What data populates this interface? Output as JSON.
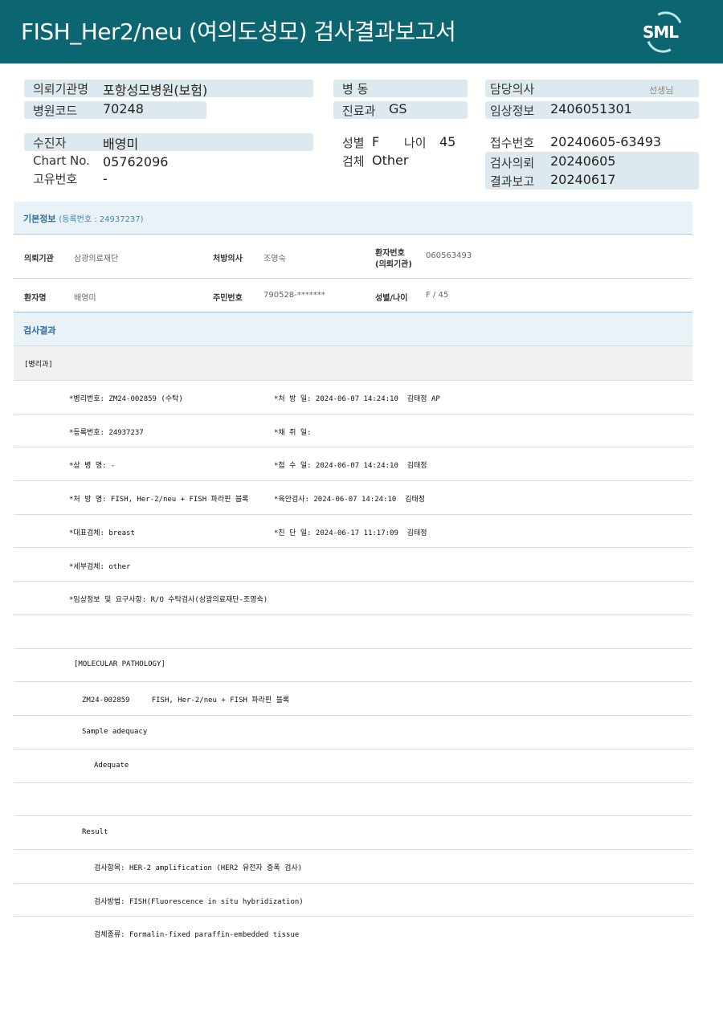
{
  "header": {
    "title": "FISH_Her2/neu (여의도성모) 검사결과보고서",
    "logo_text": "SML"
  },
  "summary": {
    "institution": {
      "label": "의뢰기관명",
      "value": "포항성모병원(보험)"
    },
    "hospital_code": {
      "label": "병원코드",
      "value": "70248"
    },
    "ward": {
      "label": "병   동",
      "value": ""
    },
    "department": {
      "label": "진료과",
      "value": "GS"
    },
    "doctor": {
      "label": "담당의사",
      "value": "",
      "suffix": "선생님"
    },
    "clinical_info": {
      "label": "임상정보",
      "value": "2406051301"
    },
    "patient": {
      "label": "수진자",
      "value": "배영미"
    },
    "chart_no": {
      "label": "Chart No.",
      "value": "05762096"
    },
    "unique_no": {
      "label": "고유번호",
      "value": "-"
    },
    "sex": {
      "label": "성별",
      "value": "F"
    },
    "age": {
      "label": "나이",
      "value": "45"
    },
    "specimen": {
      "label": "검체",
      "value": "Other"
    },
    "receipt_no": {
      "label": "접수번호",
      "value": "20240605-63493"
    },
    "request_date": {
      "label": "검사의뢰",
      "value": "20240605"
    },
    "report_date": {
      "label": "결과보고",
      "value": "20240617"
    }
  },
  "basic_info": {
    "title": "기본정보",
    "reg_label": "(등록번호 : 24937237)",
    "institution_label": "의뢰기관",
    "institution_value": "삼광의료재단",
    "physician_label": "처방의사",
    "physician_value": "조영숙",
    "patient_no_label_1": "환자번호",
    "patient_no_label_2": "(의뢰기관)",
    "patient_no_value": "060563493",
    "patient_name_label": "환자명",
    "patient_name_value": "배영미",
    "resident_no_label": "주민번호",
    "resident_no_value": "790528-*******",
    "sex_age_label": "성별/나이",
    "sex_age_value": "F / 45"
  },
  "results": {
    "title": "검사결과",
    "dept": "[병리과]",
    "lines": [
      {
        "left": "*병리번호: ZM24-002859 (수탁)",
        "right": "*처 방 일: 2024-06-07 14:24:10  김태정 AP"
      },
      {
        "left": "*등록번호: 24937237",
        "right": "*채 취 일:"
      },
      {
        "left": "*상 병 명: -",
        "right": "*접 수 일: 2024-06-07 14:24:10  김태정"
      },
      {
        "left": "*처 방 명: FISH, Her-2/neu + FISH 파라핀 블록",
        "right": "*육안검사: 2024-06-07 14:24:10  김태정"
      },
      {
        "left": "*대표검체: breast",
        "right": "*진 단 일: 2024-06-17 11:17:09  김태정"
      },
      {
        "left": "*세부검체: other",
        "right": ""
      },
      {
        "left": "*임상정보 및 요구사항: R/O 수탁검사(삼광의료재단-조영숙)",
        "right": ""
      }
    ],
    "molecular": "[MOLECULAR PATHOLOGY]",
    "test_line": "ZM24-002859     FISH, Her-2/neu + FISH 파라핀 블록",
    "sample_adequacy": "Sample adequacy",
    "adequate": "Adequate",
    "result": "Result",
    "item": "검사항목: HER-2 amplification (HER2 유전자 증폭 검사)",
    "method": "검사방법: FISH(Fluorescence in situ hybridization)",
    "specimen_type": "검체종류: Formalin-fixed paraffin-embedded tissue"
  }
}
